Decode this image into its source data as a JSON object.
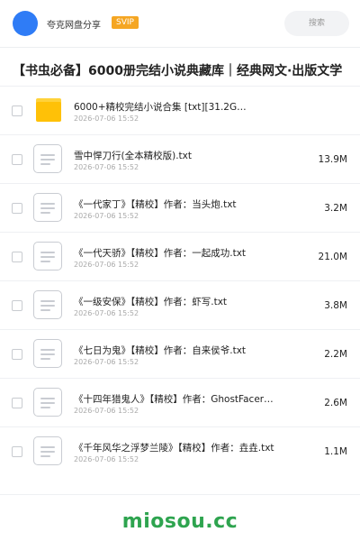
{
  "header": {
    "brand": "夸克网盘分享",
    "badge": "SVIP",
    "search_placeholder": "搜索"
  },
  "page_title": "【书虫必备】6000册完结小说典藏库｜经典网文·出版文学",
  "files": [
    {
      "name": "6000+精校完结小说合集 [txt][31.2G…",
      "date": "2026-07-06 15:52",
      "size": "",
      "type": "folder-icon"
    },
    {
      "name": "雪中悍刀行(全本精校版).txt",
      "date": "2026-07-06 15:52",
      "size": "13.9M",
      "type": "document-icon"
    },
    {
      "name": "《一代家丁》【精校】作者：当头炮.txt",
      "date": "2026-07-06 15:52",
      "size": "3.2M",
      "type": "document-icon"
    },
    {
      "name": "《一代天骄》【精校】作者：一起成功.txt",
      "date": "2026-07-06 15:52",
      "size": "21.0M",
      "type": "document-icon"
    },
    {
      "name": "《一级安保》【精校】作者：虾写.txt",
      "date": "2026-07-06 15:52",
      "size": "3.8M",
      "type": "document-icon"
    },
    {
      "name": "《七日为鬼》【精校】作者：自来侯爷.txt",
      "date": "2026-07-06 15:52",
      "size": "2.2M",
      "type": "document-icon"
    },
    {
      "name": "《十四年猎鬼人》【精校】作者：GhostFacer…",
      "date": "2026-07-06 15:52",
      "size": "2.6M",
      "type": "document-icon"
    },
    {
      "name": "《千年风华之浮梦兰陵》【精校】作者：垚垚.txt",
      "date": "2026-07-06 15:52",
      "size": "1.1M",
      "type": "document-icon"
    }
  ],
  "watermark": "miosou.cc",
  "colors": {
    "accent": "#2f7cf6",
    "badge": "#f5a623",
    "folder": "#ffc107",
    "watermark": "#2ea44f"
  }
}
